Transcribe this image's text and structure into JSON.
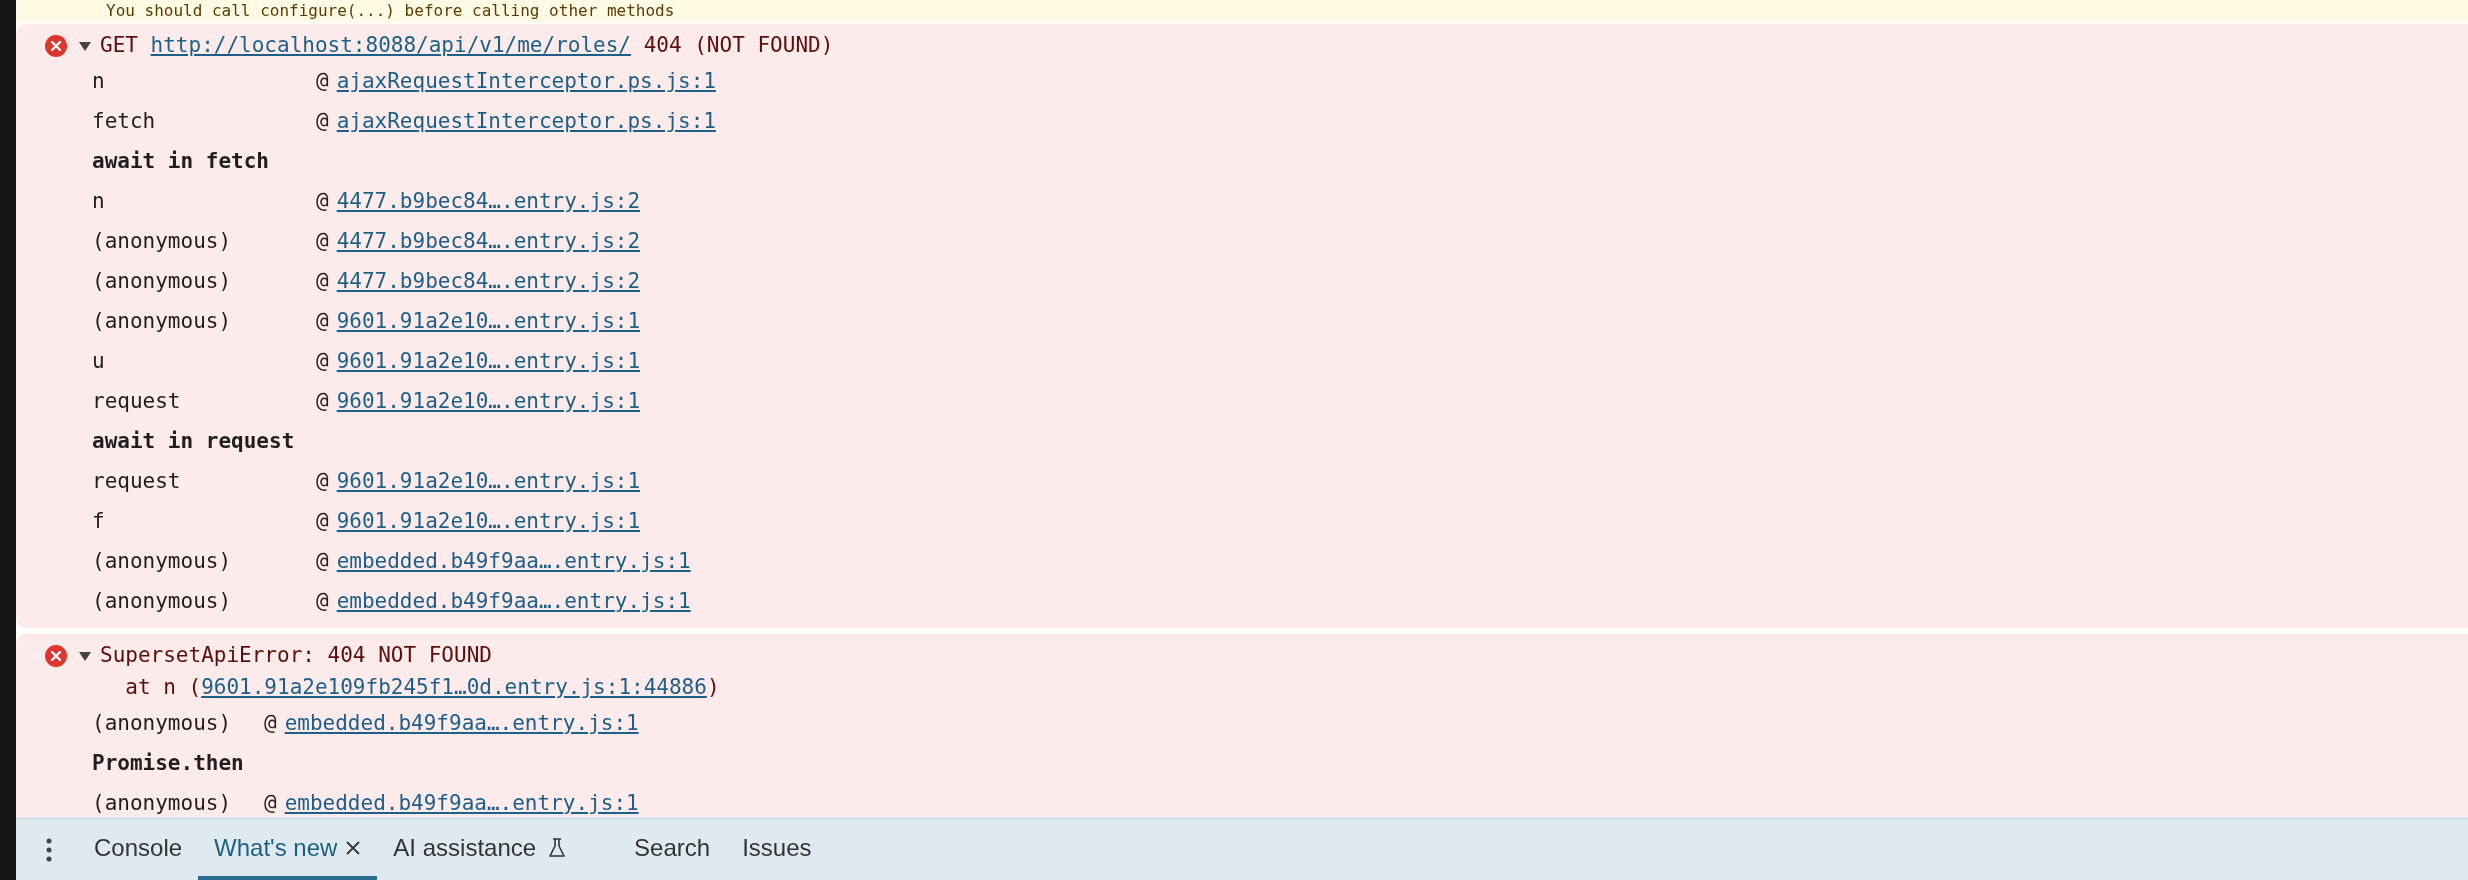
{
  "warning": {
    "text": "You should call configure(...) before calling other methods"
  },
  "messages": [
    {
      "kind": "error",
      "expanded": true,
      "lines": [
        [
          {
            "text": "GET "
          },
          {
            "link": "http://localhost:8088/api/v1/me/roles/"
          },
          {
            "text": " 404 (NOT FOUND)"
          }
        ]
      ],
      "stack": [
        {
          "kind": "frame",
          "function": "n",
          "separator": "@",
          "location": "ajaxRequestInterceptor.ps.js:1"
        },
        {
          "kind": "frame",
          "function": "fetch",
          "separator": "@",
          "location": "ajaxRequestInterceptor.ps.js:1"
        },
        {
          "kind": "async",
          "label": "await in fetch"
        },
        {
          "kind": "frame",
          "function": "n",
          "separator": "@",
          "location": "4477.b9bec84….entry.js:2"
        },
        {
          "kind": "frame",
          "function": "(anonymous)",
          "separator": "@",
          "location": "4477.b9bec84….entry.js:2"
        },
        {
          "kind": "frame",
          "function": "(anonymous)",
          "separator": "@",
          "location": "4477.b9bec84….entry.js:2"
        },
        {
          "kind": "frame",
          "function": "(anonymous)",
          "separator": "@",
          "location": "9601.91a2e10….entry.js:1"
        },
        {
          "kind": "frame",
          "function": "u",
          "separator": "@",
          "location": "9601.91a2e10….entry.js:1"
        },
        {
          "kind": "frame",
          "function": "request",
          "separator": "@",
          "location": "9601.91a2e10….entry.js:1"
        },
        {
          "kind": "async",
          "label": "await in request"
        },
        {
          "kind": "frame",
          "function": "request",
          "separator": "@",
          "location": "9601.91a2e10….entry.js:1"
        },
        {
          "kind": "frame",
          "function": "f",
          "separator": "@",
          "location": "9601.91a2e10….entry.js:1"
        },
        {
          "kind": "frame",
          "function": "(anonymous)",
          "separator": "@",
          "location": "embedded.b49f9aa….entry.js:1"
        },
        {
          "kind": "frame",
          "function": "(anonymous)",
          "separator": "@",
          "location": "embedded.b49f9aa….entry.js:1"
        }
      ]
    },
    {
      "kind": "error",
      "expanded": true,
      "lines": [
        [
          {
            "text": "SupersetApiError: 404 NOT FOUND"
          }
        ],
        [
          {
            "text": "  at n ("
          },
          {
            "link": "9601.91a2e109fb245f1…0d.entry.js:1:44886"
          },
          {
            "text": ")"
          }
        ]
      ],
      "stack": [
        {
          "kind": "frame",
          "function": "(anonymous)",
          "separator": "@",
          "location": "embedded.b49f9aa….entry.js:1"
        },
        {
          "kind": "async",
          "label": "Promise.then"
        },
        {
          "kind": "frame",
          "function": "(anonymous)",
          "separator": "@",
          "location": "embedded.b49f9aa….entry.js:1"
        }
      ]
    }
  ],
  "tabs": [
    {
      "label": "Console",
      "selected": false,
      "closable": false,
      "experimental": false
    },
    {
      "label": "What's new",
      "selected": true,
      "closable": true,
      "experimental": false
    },
    {
      "label": "AI assistance",
      "selected": false,
      "closable": false,
      "experimental": true
    },
    {
      "label": "Search",
      "selected": false,
      "closable": false,
      "experimental": false
    },
    {
      "label": "Issues",
      "selected": false,
      "closable": false,
      "experimental": false
    }
  ]
}
